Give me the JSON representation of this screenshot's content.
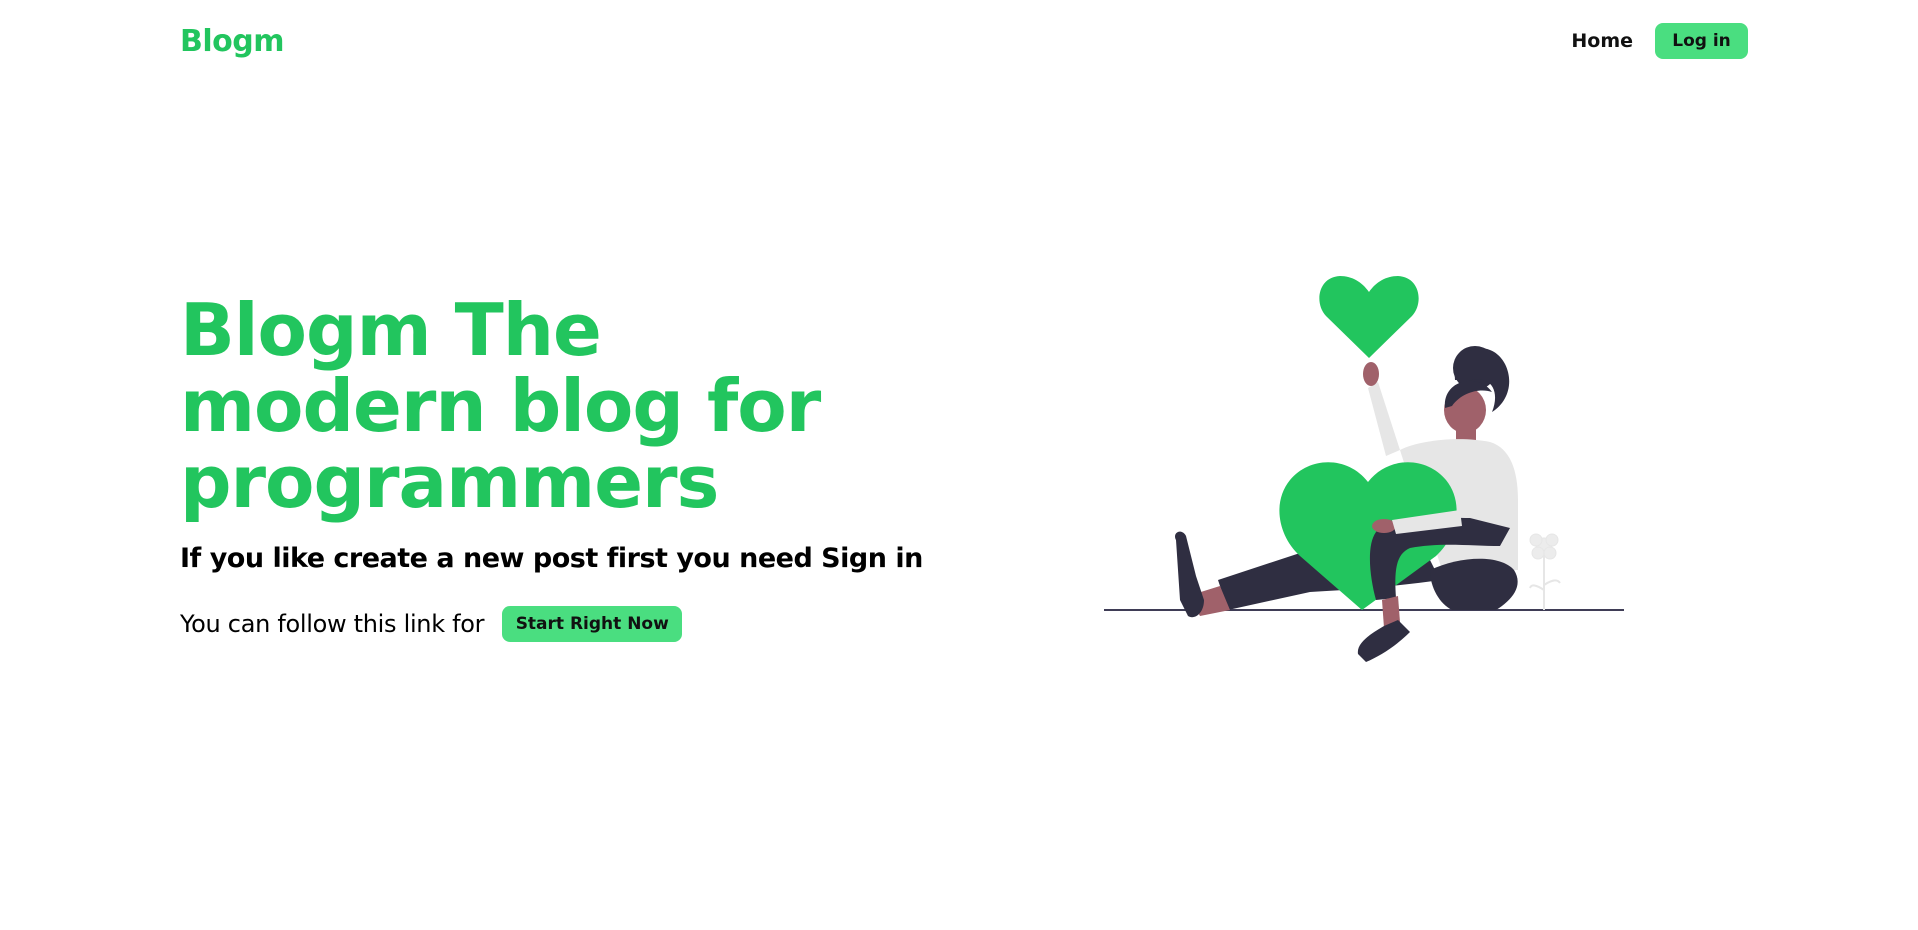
{
  "header": {
    "brand": "Blogm",
    "nav": {
      "home_label": "Home",
      "login_label": "Log in"
    }
  },
  "hero": {
    "title": "Blogm The modern blog for programmers",
    "subtitle": "If you like create a new post first you need Sign in",
    "cta_text": "You can follow this link for",
    "cta_button_label": "Start Right Now"
  },
  "illustration": {
    "icon": "woman-with-hearts-illustration"
  },
  "colors": {
    "accent": "#22c55e",
    "button_bg": "#4ade80",
    "text": "#000000",
    "background": "#ffffff",
    "figure_dark": "#2f2e41",
    "figure_skin": "#a0616a",
    "figure_shirt": "#e6e6e6"
  }
}
